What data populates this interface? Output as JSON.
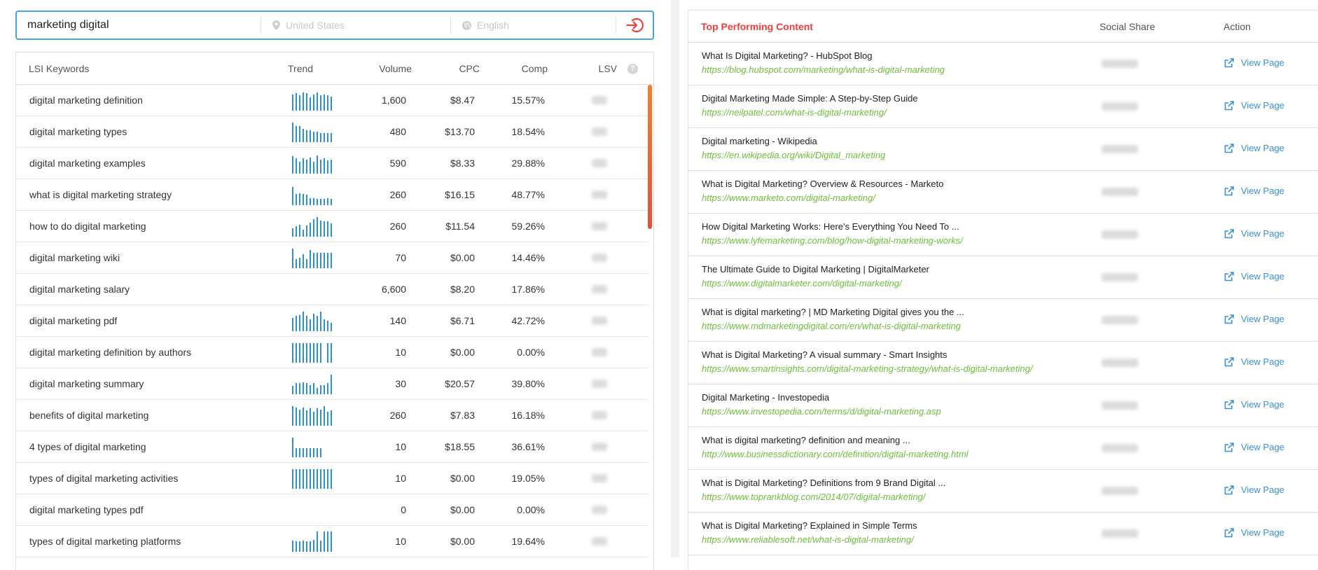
{
  "search": {
    "keyword": "marketing digital",
    "country_placeholder": "United States",
    "language_placeholder": "English",
    "go_icon": "enter-icon"
  },
  "lsi": {
    "headers": {
      "keyword": "LSI Keywords",
      "trend": "Trend",
      "volume": "Volume",
      "cpc": "CPC",
      "comp": "Comp",
      "lsv": "LSV",
      "help": "?"
    },
    "rows": [
      {
        "keyword": "digital marketing definition",
        "volume": "1,600",
        "cpc": "$8.47",
        "comp": "15.57%",
        "trend": [
          0.8,
          0.85,
          0.75,
          0.9,
          0.85,
          0.65,
          0.8,
          0.9,
          0.75,
          0.8,
          0.75,
          0.7
        ]
      },
      {
        "keyword": "digital marketing types",
        "volume": "480",
        "cpc": "$13.70",
        "comp": "18.54%",
        "trend": [
          0.95,
          0.8,
          0.8,
          0.65,
          0.6,
          0.6,
          0.5,
          0.5,
          0.45,
          0.45,
          0.45,
          0.45
        ]
      },
      {
        "keyword": "digital marketing examples",
        "volume": "590",
        "cpc": "$8.33",
        "comp": "29.88%",
        "trend": [
          0.85,
          0.75,
          0.6,
          0.75,
          0.7,
          0.8,
          0.6,
          0.9,
          0.7,
          0.75,
          0.65,
          0.7
        ]
      },
      {
        "keyword": "what is digital marketing strategy",
        "volume": "260",
        "cpc": "$16.15",
        "comp": "48.77%",
        "trend": [
          0.9,
          0.55,
          0.6,
          0.55,
          0.5,
          0.35,
          0.35,
          0.3,
          0.3,
          0.3,
          0.35,
          0.3
        ]
      },
      {
        "keyword": "how to do digital marketing",
        "volume": "260",
        "cpc": "$11.54",
        "comp": "59.26%",
        "trend": [
          0.4,
          0.5,
          0.6,
          0.35,
          0.55,
          0.7,
          0.85,
          0.95,
          0.8,
          0.75,
          0.75,
          0.65
        ]
      },
      {
        "keyword": "digital marketing wiki",
        "volume": "70",
        "cpc": "$0.00",
        "comp": "14.46%",
        "trend": [
          0.95,
          0.45,
          0.5,
          0.7,
          0.45,
          0.9,
          0.75,
          0.75,
          0.75,
          0.75,
          0.75,
          0.75
        ]
      },
      {
        "keyword": "digital marketing salary",
        "volume": "6,600",
        "cpc": "$8.20",
        "comp": "17.86%",
        "trend": []
      },
      {
        "keyword": "digital marketing pdf",
        "volume": "140",
        "cpc": "$6.71",
        "comp": "42.72%",
        "trend": [
          0.65,
          0.75,
          0.8,
          0.95,
          0.75,
          0.6,
          0.85,
          0.75,
          0.95,
          0.6,
          0.5,
          0.4
        ]
      },
      {
        "keyword": "digital marketing definition by authors",
        "volume": "10",
        "cpc": "$0.00",
        "comp": "0.00%",
        "trend": [
          0.95,
          0.95,
          0.95,
          0.95,
          0.95,
          0.95,
          0.95,
          0.95,
          0.95,
          0.0,
          0.95,
          0.95
        ]
      },
      {
        "keyword": "digital marketing summary",
        "volume": "30",
        "cpc": "$20.57",
        "comp": "39.80%",
        "trend": [
          0.4,
          0.55,
          0.55,
          0.6,
          0.55,
          0.45,
          0.55,
          0.3,
          0.45,
          0.45,
          0.55,
          0.95
        ]
      },
      {
        "keyword": "benefits of digital marketing",
        "volume": "260",
        "cpc": "$7.83",
        "comp": "16.18%",
        "trend": [
          0.95,
          0.9,
          0.8,
          0.9,
          0.75,
          0.85,
          0.7,
          0.85,
          0.8,
          0.95,
          0.7,
          0.75
        ]
      },
      {
        "keyword": "4 types of digital marketing",
        "volume": "10",
        "cpc": "$18.55",
        "comp": "36.61%",
        "trend": [
          0.95,
          0.45,
          0.45,
          0.45,
          0.45,
          0.45,
          0.45,
          0.45,
          0.45
        ]
      },
      {
        "keyword": "types of digital marketing activities",
        "volume": "10",
        "cpc": "$0.00",
        "comp": "19.05%",
        "trend": [
          0.95,
          0.95,
          0.95,
          0.95,
          0.95,
          0.95,
          0.95,
          0.95,
          0.95,
          0.95,
          0.95,
          0.95
        ]
      },
      {
        "keyword": "digital marketing types pdf",
        "volume": "0",
        "cpc": "$0.00",
        "comp": "0.00%",
        "trend": []
      },
      {
        "keyword": "types of digital marketing platforms",
        "volume": "10",
        "cpc": "$0.00",
        "comp": "19.64%",
        "trend": [
          0.55,
          0.5,
          0.5,
          0.55,
          0.5,
          0.5,
          0.6,
          1.0,
          0.55,
          1.0,
          1.0,
          1.0
        ]
      }
    ]
  },
  "content": {
    "headers": {
      "title": "Top Performing Content",
      "share": "Social Share",
      "action": "Action"
    },
    "view_label": "View Page",
    "rows": [
      {
        "title": "What Is Digital Marketing? - HubSpot Blog",
        "url": "https://blog.hubspot.com/marketing/what-is-digital-marketing"
      },
      {
        "title": "Digital Marketing Made Simple: A Step-by-Step Guide",
        "url": "https://neilpatel.com/what-is-digital-marketing/"
      },
      {
        "title": "Digital marketing - Wikipedia",
        "url": "https://en.wikipedia.org/wiki/Digital_marketing"
      },
      {
        "title": "What is Digital Marketing? Overview & Resources - Marketo",
        "url": "https://www.marketo.com/digital-marketing/"
      },
      {
        "title": "How Digital Marketing Works: Here's Everything You Need To ...",
        "url": "https://www.lyfemarketing.com/blog/how-digital-marketing-works/"
      },
      {
        "title": "The Ultimate Guide to Digital Marketing | DigitalMarketer",
        "url": "https://www.digitalmarketer.com/digital-marketing/"
      },
      {
        "title": "What is digital marketing? | MD Marketing Digital gives you the ...",
        "url": "https://www.mdmarketingdigital.com/en/what-is-digital-marketing"
      },
      {
        "title": "What is Digital Marketing? A visual summary - Smart Insights",
        "url": "https://www.smartinsights.com/digital-marketing-strategy/what-is-digital-marketing/"
      },
      {
        "title": "Digital Marketing - Investopedia",
        "url": "https://www.investopedia.com/terms/d/digital-marketing.asp"
      },
      {
        "title": "What is digital marketing? definition and meaning ...",
        "url": "http://www.businessdictionary.com/definition/digital-marketing.html"
      },
      {
        "title": "What is Digital Marketing? Definitions from 9 Brand Digital ...",
        "url": "https://www.toprankblog.com/2014/07/digital-marketing/"
      },
      {
        "title": "What is Digital Marketing? Explained in Simple Terms",
        "url": "https://www.reliablesoft.net/what-is-digital-marketing/"
      }
    ]
  },
  "colors": {
    "accent": "#4aa3df",
    "brand_red": "#ef3d3d",
    "url_green": "#6dbf3a",
    "link_blue": "#3a8fd9",
    "trend_bar": "#2b8fd0"
  }
}
